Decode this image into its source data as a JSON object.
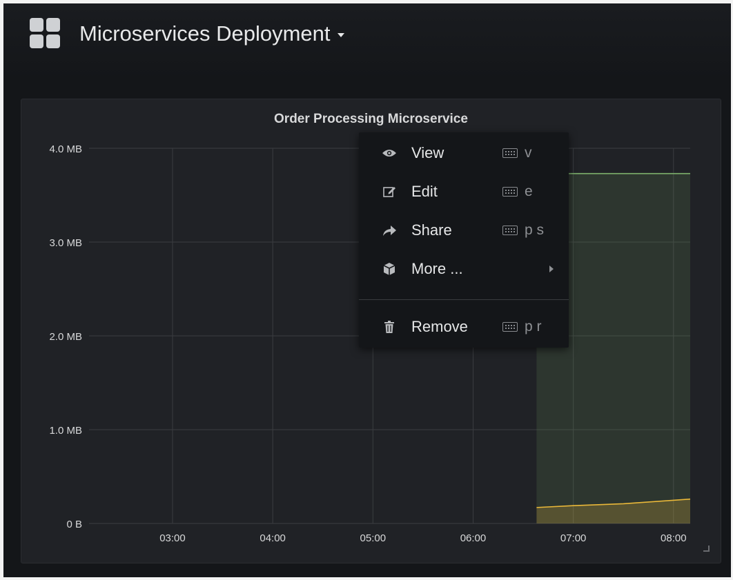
{
  "dashboard": {
    "title": "Microservices Deployment",
    "icon": "dashboard-grid-icon"
  },
  "panel": {
    "title": "Order Processing Microservice"
  },
  "chart_data": {
    "type": "area",
    "title": "Order Processing Microservice",
    "xlabel": "",
    "ylabel": "",
    "x_ticks": [
      "03:00",
      "04:00",
      "05:00",
      "06:00",
      "07:00",
      "08:00"
    ],
    "y_ticks": [
      {
        "value": 0,
        "label": "0 B"
      },
      {
        "value": 1,
        "label": "1.0 MB"
      },
      {
        "value": 2,
        "label": "2.0 MB"
      },
      {
        "value": 3,
        "label": "3.0 MB"
      },
      {
        "value": 4,
        "label": "4.0 MB"
      }
    ],
    "ylim": [
      0,
      4
    ],
    "grid": true,
    "series": [
      {
        "color": "#7eb26d",
        "x": [
          "06:38",
          "08:10"
        ],
        "values": [
          3.73,
          3.73
        ]
      },
      {
        "color": "#eab839",
        "x": [
          "06:38",
          "07:00",
          "07:30",
          "08:10"
        ],
        "values": [
          0.17,
          0.19,
          0.21,
          0.26
        ]
      }
    ]
  },
  "context_menu": {
    "items": [
      {
        "label": "View",
        "icon": "eye-icon",
        "shortcut": "v"
      },
      {
        "label": "Edit",
        "icon": "edit-icon",
        "shortcut": "e"
      },
      {
        "label": "Share",
        "icon": "share-icon",
        "shortcut": "p s"
      },
      {
        "label": "More ...",
        "icon": "cube-icon",
        "submenu": true
      },
      {
        "label": "Remove",
        "icon": "trash-icon",
        "shortcut": "p r"
      }
    ]
  },
  "colors": {
    "background": "#141619",
    "panel": "#202226",
    "series_green": "#7eb26d",
    "series_yellow": "#eab839"
  }
}
